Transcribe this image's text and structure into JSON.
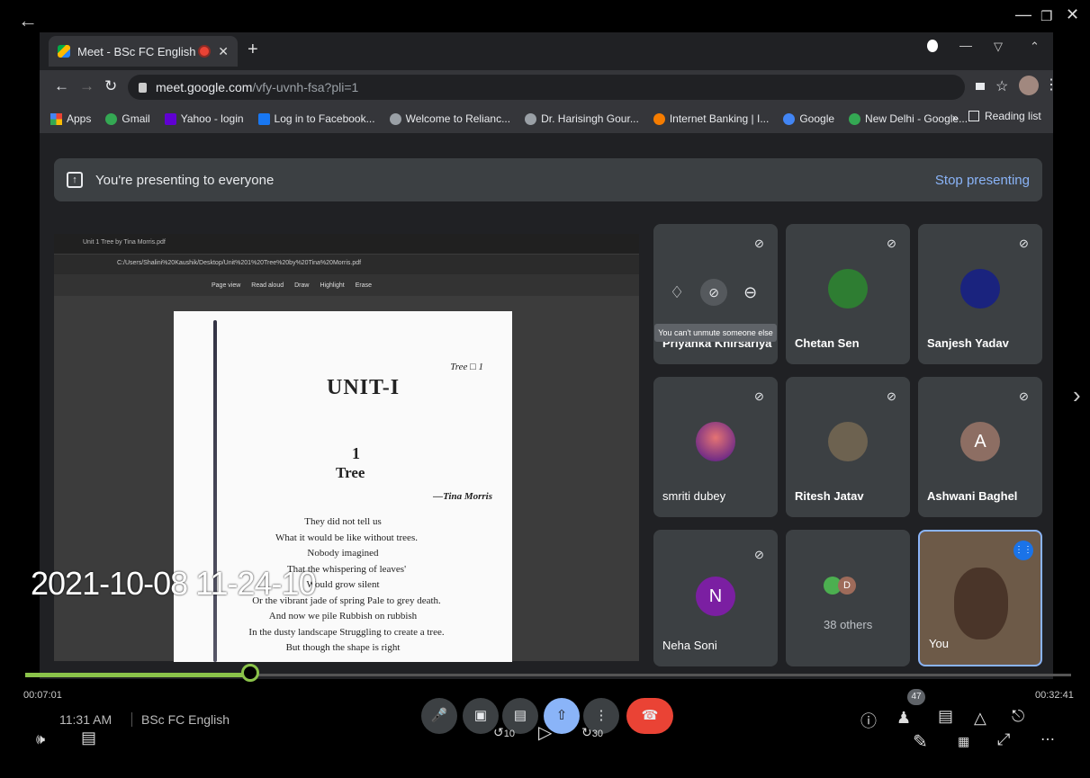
{
  "tab": {
    "title": "Meet - BSc FC English"
  },
  "address": {
    "host": "meet.google.com",
    "path": "/vfy-uvnh-fsa?pli=1"
  },
  "bookmarks": [
    {
      "label": "Apps",
      "color": "#ea4335"
    },
    {
      "label": "Gmail",
      "color": "#34a853"
    },
    {
      "label": "Yahoo - login",
      "color": "#6001d2"
    },
    {
      "label": "Log in to Facebook...",
      "color": "#1877f2"
    },
    {
      "label": "Welcome to Relianc...",
      "color": "#9aa0a6"
    },
    {
      "label": "Dr. Harisingh Gour...",
      "color": "#9aa0a6"
    },
    {
      "label": "Internet Banking | I...",
      "color": "#f57c00"
    },
    {
      "label": "Google",
      "color": "#4285f4"
    },
    {
      "label": "New Delhi - Google...",
      "color": "#34a853"
    }
  ],
  "reading_list": "Reading list",
  "banner": {
    "text": "You're presenting to everyone",
    "stop": "Stop presenting"
  },
  "shared": {
    "tab": "Unit 1 Tree by Tina Morris.pdf",
    "url": "C:/Users/Shalini%20Kaushik/Desktop/Unit%201%20Tree%20by%20Tina%20Morris.pdf",
    "toolbar": [
      "Page view",
      "Read aloud",
      "Draw",
      "Highlight",
      "Erase"
    ],
    "page_header": "Tree □ 1",
    "unit": "UNIT-I",
    "number": "1",
    "title": "Tree",
    "author": "—Tina Morris",
    "lines": [
      "They did not tell us",
      "What it would be like without trees.",
      "Nobody imagined",
      "That the whispering of leaves'",
      "Would grow silent",
      "Or the vibrant jade of spring Pale to grey death.",
      "And now we pile Rubbish on rubbish",
      "In the dusty landscape Struggling to create a tree.",
      "But though the shape is right"
    ]
  },
  "tooltip": "You can't unmute someone else",
  "participants": [
    {
      "name": "Priyanka Khirsariya",
      "avatar_color": "#5f6368"
    },
    {
      "name": "Chetan Sen",
      "avatar_color": "#2e7d32"
    },
    {
      "name": "Sanjesh Yadav",
      "avatar_color": "#1a237e"
    },
    {
      "name": "smriti dubey",
      "avatar_color": "#4a148c"
    },
    {
      "name": "Ritesh Jatav",
      "avatar_color": "#6d6250"
    },
    {
      "name": "Ashwani Baghel",
      "initial": "A",
      "avatar_color": "#8d6e63"
    },
    {
      "name": "Neha Soni",
      "initial": "N",
      "avatar_color": "#7b1fa2"
    },
    {
      "name": "38 others",
      "initial": "D",
      "avatar_color": "#9e6b5a"
    },
    {
      "name": "You",
      "avatar_color": "#b98567"
    }
  ],
  "overlay_timestamp": "2021-10-08 11-24-10",
  "player": {
    "elapsed": "00:07:01",
    "total": "00:32:41",
    "progress": 0.215,
    "rewind": "10",
    "forward": "30"
  },
  "meet_footer": {
    "time": "11:31 AM",
    "title": "BSc FC English",
    "people_count": "47"
  }
}
